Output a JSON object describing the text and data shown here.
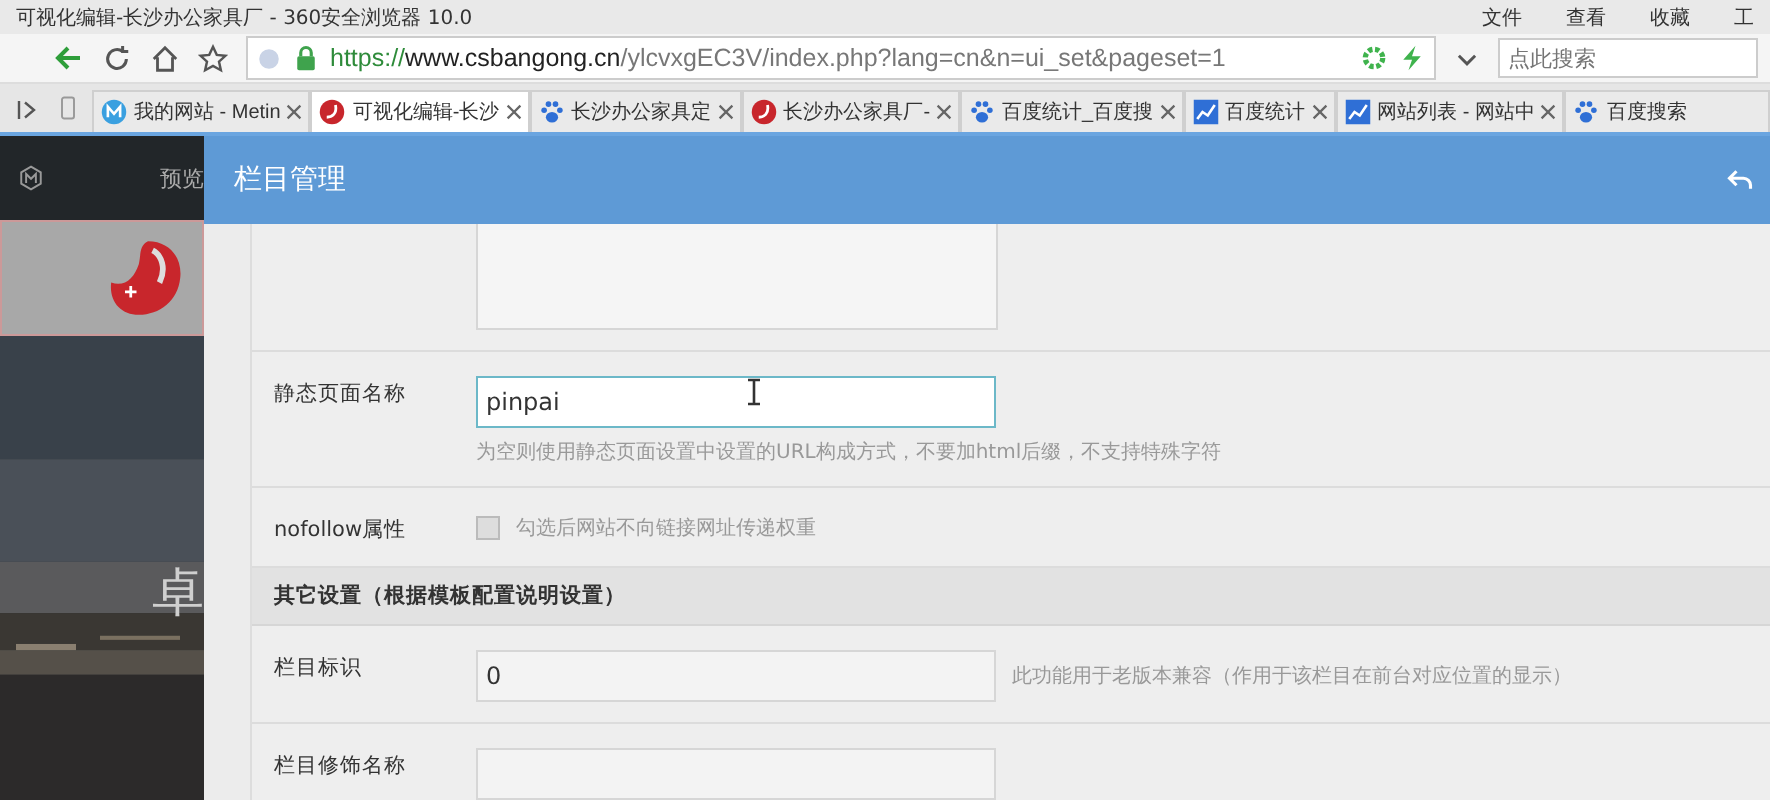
{
  "window": {
    "title": "可视化编辑-长沙办公家具厂 - 360安全浏览器 10.0",
    "menu": [
      "文件",
      "查看",
      "收藏",
      "工"
    ]
  },
  "address_bar": {
    "scheme": "https://",
    "domain": "www.csbangong.cn",
    "path": "/ylcvxgEC3V/index.php?lang=cn&n=ui_set&pageset=1",
    "search_placeholder": "点此搜索"
  },
  "tabs": [
    {
      "label": "我的网站 - Metin",
      "selected": false
    },
    {
      "label": "可视化编辑-长沙",
      "selected": true
    },
    {
      "label": "长沙办公家具定",
      "selected": false
    },
    {
      "label": "长沙办公家具厂-",
      "selected": false
    },
    {
      "label": "百度统计_百度搜",
      "selected": false
    },
    {
      "label": "百度统计",
      "selected": false
    },
    {
      "label": "网站列表 - 网站中",
      "selected": false
    },
    {
      "label": "百度搜索",
      "selected": false
    }
  ],
  "site": {
    "nav_label": "预览",
    "banner_text": "卓"
  },
  "dialog": {
    "title": "栏目管理",
    "rows": [
      {
        "kind": "textarea"
      },
      {
        "kind": "input",
        "label": "静态页面名称",
        "value": "pinpai",
        "focused": true,
        "hint": "为空则使用静态页面设置中设置的URL构成方式，不要加html后缀，不支持特殊字符"
      },
      {
        "kind": "checkbox",
        "label": "nofollow属性",
        "checked": false,
        "text": "勾选后网站不向链接网址传递权重"
      },
      {
        "kind": "section",
        "label": "其它设置（根据模板配置说明设置）"
      },
      {
        "kind": "input",
        "label": "栏目标识",
        "value": "0",
        "focused": false,
        "note": "此功能用于老版本兼容（作用于该栏目在前台对应位置的显示）"
      },
      {
        "kind": "input",
        "label": "栏目修饰名称",
        "value": "",
        "focused": false
      }
    ]
  }
}
